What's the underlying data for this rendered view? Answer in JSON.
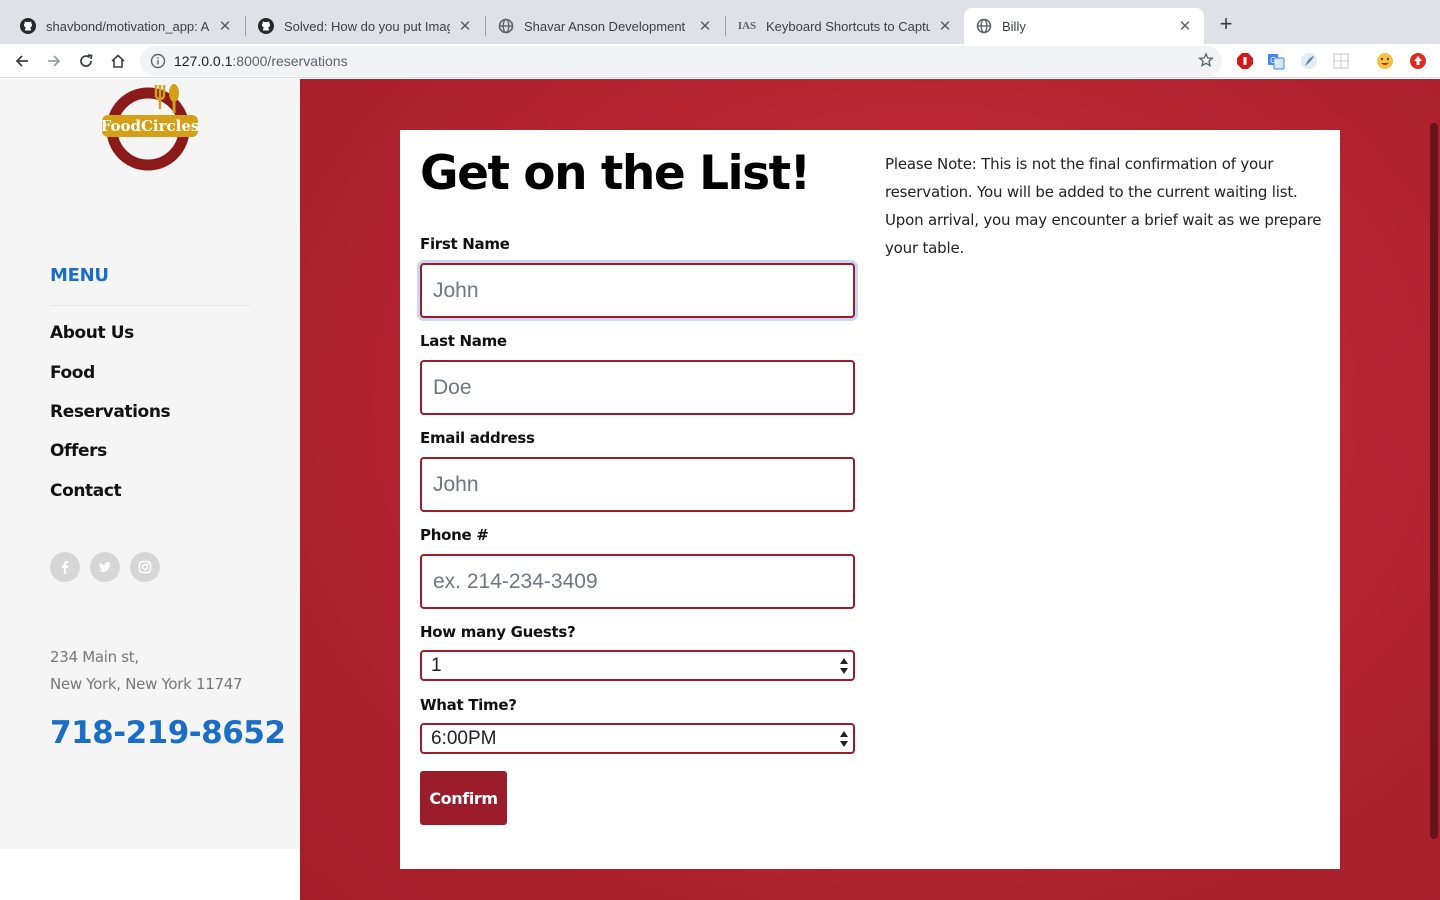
{
  "browser": {
    "tabs": [
      {
        "title": "shavbond/motivation_app: A si",
        "icon": "github-icon"
      },
      {
        "title": "Solved: How do you put Image",
        "icon": "github-icon"
      },
      {
        "title": "Shavar Anson Development",
        "icon": "globe-icon"
      },
      {
        "title": "Keyboard Shortcuts to Capture",
        "icon": "ias-icon",
        "icon_text": "IAS"
      },
      {
        "title": "Billy",
        "icon": "globe-icon",
        "active": true
      }
    ],
    "url_host": "127.0.0.1",
    "url_rest": ":8000/reservations"
  },
  "sidebar": {
    "logo_text": "FoodCircles",
    "menu_heading": "MENU",
    "menu_items": [
      "About Us",
      "Food",
      "Reservations",
      "Offers",
      "Contact"
    ],
    "social": [
      {
        "name": "facebook-icon",
        "glyph": "f"
      },
      {
        "name": "twitter-icon",
        "glyph": "t"
      },
      {
        "name": "instagram-icon",
        "glyph": "◎"
      }
    ],
    "address_line1": "234 Main st,",
    "address_line2": "New York, New York 11747",
    "phone": "718-219-8652"
  },
  "form": {
    "title": "Get on the List!",
    "note": "Please Note: This is not the final confirmation of your reservation. You will be added to the current waiting list. Upon arrival, you may encounter a brief wait as we prepare your table.",
    "first_name_label": "First Name",
    "first_name_placeholder": "John",
    "last_name_label": "Last Name",
    "last_name_placeholder": "Doe",
    "email_label": "Email address",
    "email_placeholder": "John",
    "phone_label": "Phone #",
    "phone_placeholder": "ex. 214-234-3409",
    "guests_label": "How many Guests?",
    "guests_value": "1",
    "time_label": "What Time?",
    "time_value": "6:00PM",
    "confirm_label": "Confirm"
  },
  "colors": {
    "brand_red": "#9b1c2b",
    "accent_blue": "#1a6ec7",
    "logo_gold": "#d4a017"
  }
}
